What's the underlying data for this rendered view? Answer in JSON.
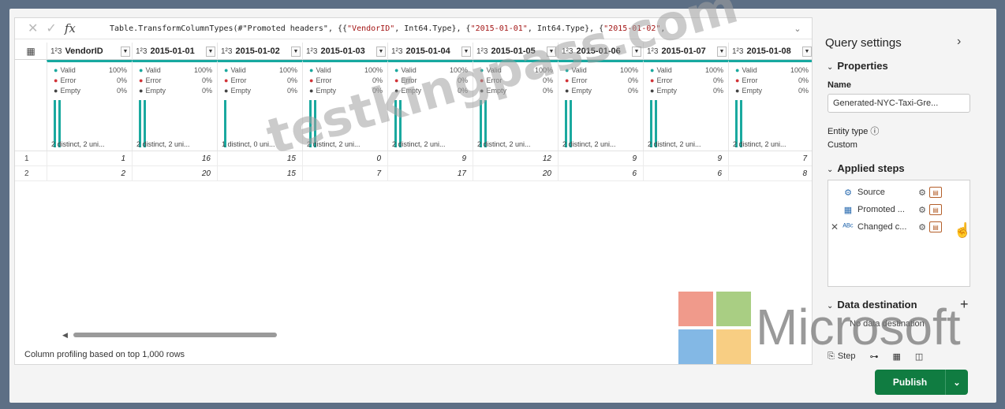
{
  "formula": {
    "prefix": "Table.TransformColumnTypes(#\"Promoted headers\", {{",
    "s1": "\"VendorID\"",
    "mid1": ", Int64.Type}, {",
    "s2": "\"2015-01-01\"",
    "mid2": ", Int64.Type}, {",
    "s3": "\"2015-01-02\"",
    "suffix": ","
  },
  "columns": [
    {
      "name": "VendorID",
      "type_icon": "1²3",
      "valid": "100%",
      "error": "0%",
      "empty": "0%",
      "distinct": "2 distinct, 2 uni...",
      "bars": 2,
      "rows": [
        "1",
        "2"
      ]
    },
    {
      "name": "2015-01-01",
      "type_icon": "1²3",
      "valid": "100%",
      "error": "0%",
      "empty": "0%",
      "distinct": "2 distinct, 2 uni...",
      "bars": 2,
      "rows": [
        "16",
        "20"
      ]
    },
    {
      "name": "2015-01-02",
      "type_icon": "1²3",
      "valid": "100%",
      "error": "0%",
      "empty": "0%",
      "distinct": "1 distinct, 0 uni...",
      "bars": 1,
      "rows": [
        "15",
        "15"
      ]
    },
    {
      "name": "2015-01-03",
      "type_icon": "1²3",
      "valid": "100%",
      "error": "0%",
      "empty": "0%",
      "distinct": "2 distinct, 2 uni...",
      "bars": 2,
      "rows": [
        "0",
        "7"
      ]
    },
    {
      "name": "2015-01-04",
      "type_icon": "1²3",
      "valid": "100%",
      "error": "0%",
      "empty": "0%",
      "distinct": "2 distinct, 2 uni...",
      "bars": 2,
      "rows": [
        "9",
        "17"
      ]
    },
    {
      "name": "2015-01-05",
      "type_icon": "1²3",
      "valid": "100%",
      "error": "0%",
      "empty": "0%",
      "distinct": "2 distinct, 2 uni...",
      "bars": 2,
      "rows": [
        "12",
        "20"
      ]
    },
    {
      "name": "2015-01-06",
      "type_icon": "1²3",
      "valid": "100%",
      "error": "0%",
      "empty": "0%",
      "distinct": "2 distinct, 2 uni...",
      "bars": 2,
      "rows": [
        "9",
        "6"
      ]
    },
    {
      "name": "2015-01-07",
      "type_icon": "1²3",
      "valid": "100%",
      "error": "0%",
      "empty": "0%",
      "distinct": "2 distinct, 2 uni...",
      "bars": 2,
      "rows": [
        "9",
        "6"
      ]
    },
    {
      "name": "2015-01-08",
      "type_icon": "1²3",
      "valid": "100%",
      "error": "0%",
      "empty": "0%",
      "distinct": "2 distinct, 2 uni...",
      "bars": 2,
      "rows": [
        "7",
        "8"
      ]
    }
  ],
  "labels": {
    "valid": "Valid",
    "error": "Error",
    "empty": "Empty"
  },
  "row_numbers": [
    "1",
    "2"
  ],
  "status": "Column profiling based on top 1,000 rows",
  "query_settings": {
    "title": "Query settings",
    "properties": "Properties",
    "name_label": "Name",
    "name_value": "Generated-NYC-Taxi-Gre...",
    "entity_type_label": "Entity type",
    "entity_type_value": "Custom",
    "applied_steps": "Applied steps",
    "steps": [
      {
        "name": "Source",
        "icon": "source-icon"
      },
      {
        "name": "Promoted ...",
        "icon": "table-icon"
      },
      {
        "name": "Changed c...",
        "icon": "abc-123-icon"
      }
    ],
    "data_destination": "Data destination",
    "no_destination": "No data destination"
  },
  "tools": {
    "step": "Step"
  },
  "publish": "Publish",
  "watermark": "testkingpass.com",
  "brand": "Microsoft",
  "colors": {
    "accent": "#107c41",
    "profile_bar": "#1aa99f",
    "valid": "#1aa99f",
    "error": "#d13438",
    "empty": "#444444"
  }
}
